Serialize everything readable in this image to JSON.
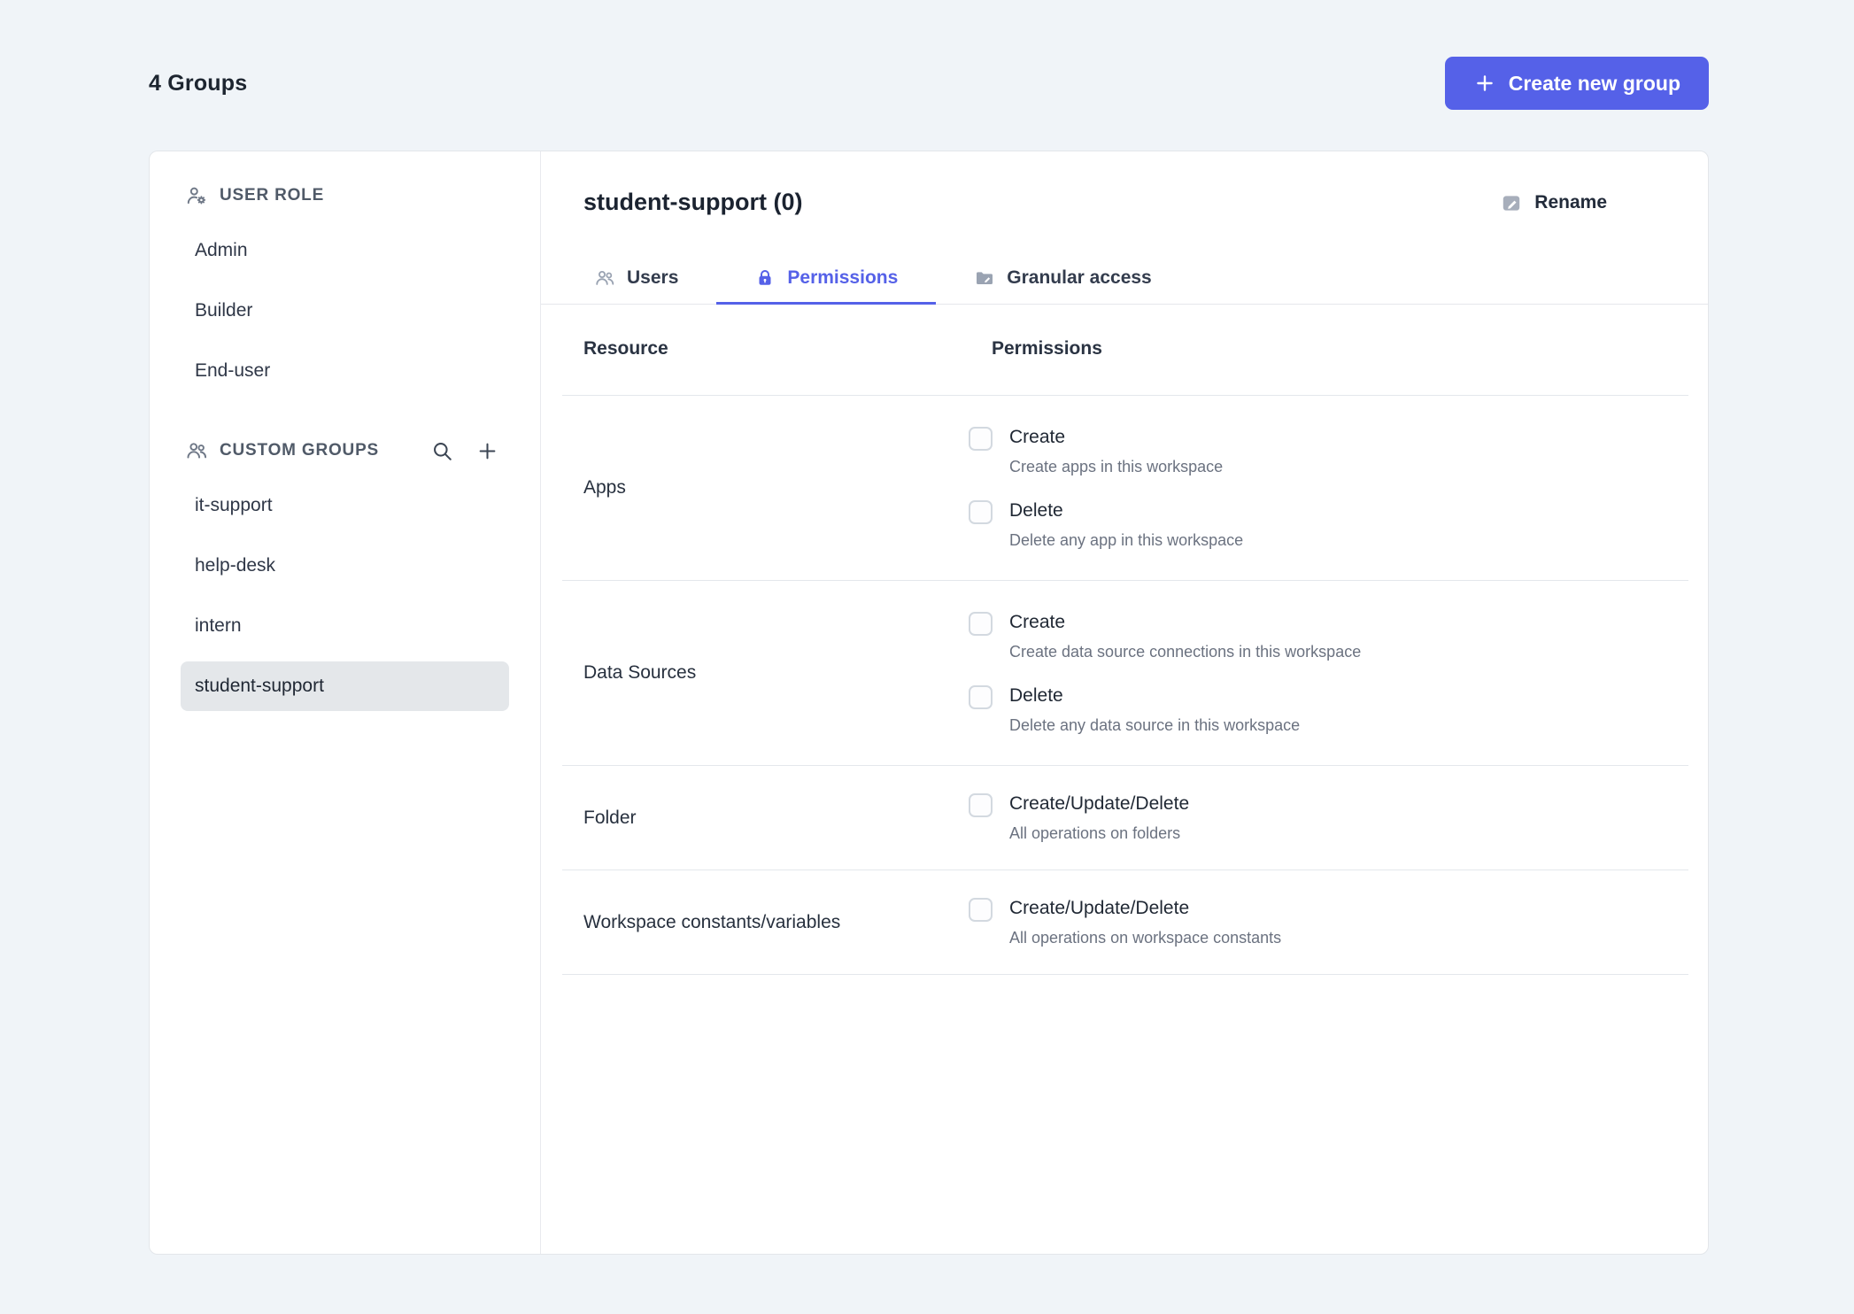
{
  "header": {
    "title": "4 Groups",
    "create_button_label": "Create new group"
  },
  "sidebar": {
    "user_role": {
      "header": "USER ROLE",
      "items": [
        {
          "label": "Admin"
        },
        {
          "label": "Builder"
        },
        {
          "label": "End-user"
        }
      ]
    },
    "custom_groups": {
      "header": "CUSTOM GROUPS",
      "items": [
        {
          "label": "it-support"
        },
        {
          "label": "help-desk"
        },
        {
          "label": "intern"
        },
        {
          "label": "student-support",
          "selected": true
        }
      ]
    }
  },
  "main": {
    "title": "student-support (0)",
    "rename_label": "Rename",
    "tabs": [
      {
        "label": "Users",
        "active": false
      },
      {
        "label": "Permissions",
        "active": true
      },
      {
        "label": "Granular access",
        "active": false
      }
    ],
    "table": {
      "resource_header": "Resource",
      "permissions_header": "Permissions",
      "rows": [
        {
          "resource": "Apps",
          "permissions": [
            {
              "label": "Create",
              "description": "Create apps in this workspace",
              "checked": false
            },
            {
              "label": "Delete",
              "description": "Delete any app in this workspace",
              "checked": false
            }
          ]
        },
        {
          "resource": "Data Sources",
          "permissions": [
            {
              "label": "Create",
              "description": "Create data source connections in this workspace",
              "checked": false
            },
            {
              "label": "Delete",
              "description": "Delete any data source in this workspace",
              "checked": false
            }
          ]
        },
        {
          "resource": "Folder",
          "permissions": [
            {
              "label": "Create/Update/Delete",
              "description": "All operations on folders",
              "checked": false
            }
          ]
        },
        {
          "resource": "Workspace constants/variables",
          "permissions": [
            {
              "label": "Create/Update/Delete",
              "description": "All operations on workspace constants",
              "checked": false
            }
          ]
        }
      ]
    }
  },
  "colors": {
    "accent": "#5561e8",
    "selected_item_bg": "#e4e7ea",
    "page_background": "#f0f4f8"
  }
}
